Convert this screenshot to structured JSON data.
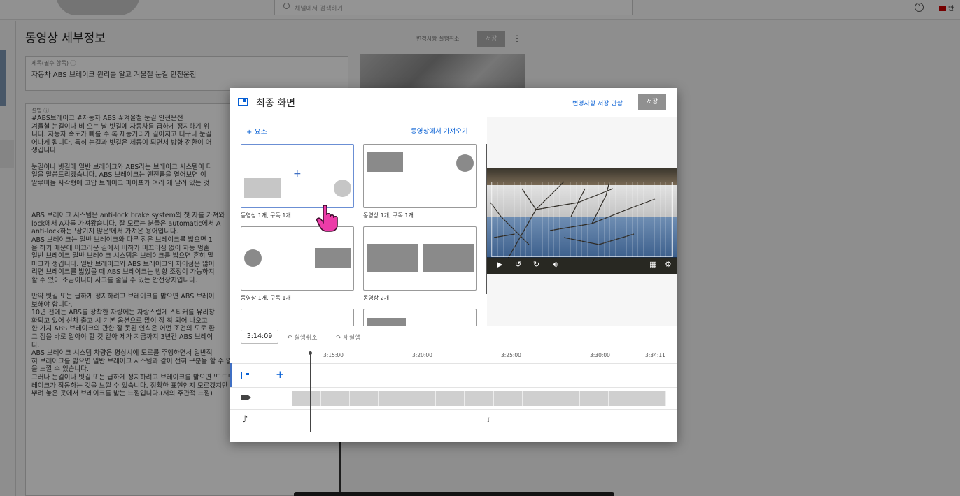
{
  "bg": {
    "search_placeholder": "채널에서 검색하기",
    "help": "?",
    "create_label": "만",
    "page_title": "동영상 세부정보",
    "undo_label": "변경사항 실행취소",
    "save_label": "저장",
    "title_field_label": "제목(필수 항목) ⓘ",
    "title_field_value": "자동차 ABS 브레이크 원리를 알고 겨울철 눈길 안전운전",
    "desc_field_label": "설명 ⓘ",
    "desc_lines": [
      "#ABS브레이크 #자동차 ABS #겨울철 눈길 안전운전",
      "겨울철 눈길이나 비 오는 날 빗길에 자동차를 급하게 정지하기 위",
      "니다. 자동차 속도가 빠를 수 록 제동거리가 길어지고 더구나 눈길",
      "어나게 됩니다. 특히 눈길과 빗길은 제동이 되면서 방향 전환이 어",
      "생깁니다.",
      "",
      "눈길이나 빗길에 일반 브레이크와 ABS라는 브레이크 시스템이 다",
      "일을 말씀드리겠습니다. ABS 브레이크는 엔진룸을 열어보면 이",
      "알루미늄 사각형에 고압 브레이크 파이프가 여러 개 달려 있는 것",
      "",
      "",
      "",
      "ABS 브레이크 시스템은 anti-lock brake system의 첫 자를 가져와",
      "lock에서 A자를 가져왔습니다. 잘 모르는 분들은 automatic에서 A",
      "anti-lock하는 '잠기지 않은'에서 가져온 용어입니다.",
      "ABS 브레이크는 일반 브레이크와 다른 점은 브레이크를 밟으면 1",
      "을 하기 때문에 미끄러운 길에서 바하가 미끄러짐 없이 자동 멈출",
      "일반 브레이크 일반 브레이크 시스템은 브레이크를 밟으면 흔히 말",
      "마크가 생깁니다. 일반 브레이크와 ABS 브레이크의 차이점은 많이",
      "리면 브레이크를 밟았을 때 ABS 브레이크는 방향 조정이 가능하지",
      "할 수 있어 조금이나마 사고를 줄일 수 있는 안전장치입니다.",
      "",
      "만약 빗길 또는 급하게 정지하려고 브레이크를 밟으면 ABS 브레이",
      "보해야 합니다.",
      "10년 전에는 ABS를 장착한 차량에는 자랑스럽게 스티커를 유리창",
      "화되고 있어 신차 출고 시 기본 옵션으로 많이 장 착 되어 나오고",
      "한 가지 ABS 브레이크의 관한 잘 못된 인식은 어떤 조건의 도로 환",
      "그 점을 바로 알아야 할 것 같아 제가 지금까지 3년간 ABS 브레이",
      "다.",
      "ABS 브레이크 시스템 차량은 평상시에 도로를 주행하면서 일반적",
      "혀 브레이크를 밟으면 일반 브레이크 시스템과 같이 전혀 구분을 할 수 없을 정도로 브레이크 작동",
      "을 느낄 수 있습니다.",
      "그러나 눈길이나 빗길 또는 급하게 정지하려고 브레이크를 밟으면 '드드드드' 하며 확실하게 ABS 브",
      "레이크가 작동하는 것을 느낄 수 있습니다. 정확한 표현인지 모르겠지만 미끄러운 길에 요래를 약간",
      "뿌려 놓은 곳에서 브레이크를 밟는 느낌입니다.(저의 주관적 느낌)"
    ]
  },
  "modal": {
    "title": "최종 화면",
    "discard_label": "변경사항 저장 안함",
    "save_label": "저장",
    "add_element_label": "+ 요소",
    "import_label": "동영상에서 가져오기",
    "templates": [
      {
        "label": "동영상 1개, 구독 1개"
      },
      {
        "label": "동영상 1개, 구독 1개"
      },
      {
        "label": "동영상 1개, 구독 1개"
      },
      {
        "label": "동영상 2개"
      }
    ],
    "current_time": "3:14:09",
    "undo_label": "실행취소",
    "redo_label": "재실행",
    "ruler": [
      "3:15:00",
      "3:20:00",
      "3:25:00",
      "3:30:00",
      "3:34:11"
    ],
    "audio_marker": "♪"
  },
  "icons": {
    "video_controls": [
      "play-icon",
      "replay-10-icon",
      "forward-10-icon",
      "volume-icon",
      "grid-icon",
      "settings-icon"
    ]
  }
}
